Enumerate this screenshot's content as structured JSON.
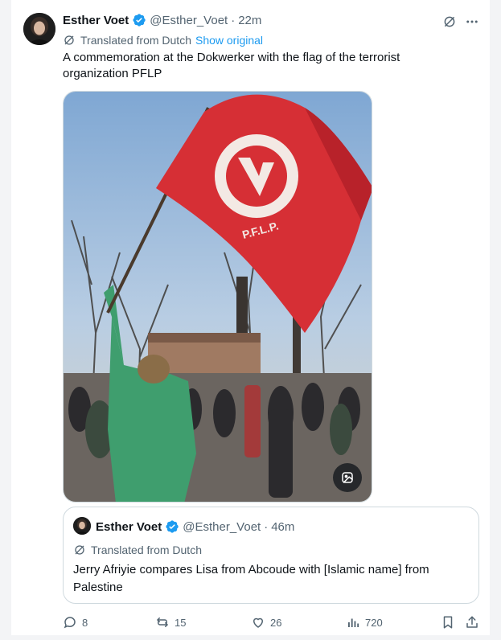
{
  "tweet": {
    "author_name": "Esther Voet",
    "handle": "@Esther_Voet",
    "separator": "·",
    "time": "22m",
    "translated_label": "Translated from Dutch",
    "show_original_label": "Show original",
    "text": "A commemoration at the Dokwerker with the flag of the terrorist organization PFLP",
    "media": {
      "flag_text": "P.F.L.P."
    }
  },
  "quote": {
    "author_name": "Esther Voet",
    "handle": "@Esther_Voet",
    "separator": "·",
    "time": "46m",
    "translated_label": "Translated from Dutch",
    "text": "Jerry Afriyie compares Lisa from Abcoude with [Islamic name] from Palestine"
  },
  "actions": {
    "replies": "8",
    "reposts": "15",
    "likes": "26",
    "views": "720"
  },
  "colors": {
    "accent": "#1d9bf0",
    "text": "#0f1419",
    "muted": "#536471",
    "border": "#cfd9de"
  }
}
